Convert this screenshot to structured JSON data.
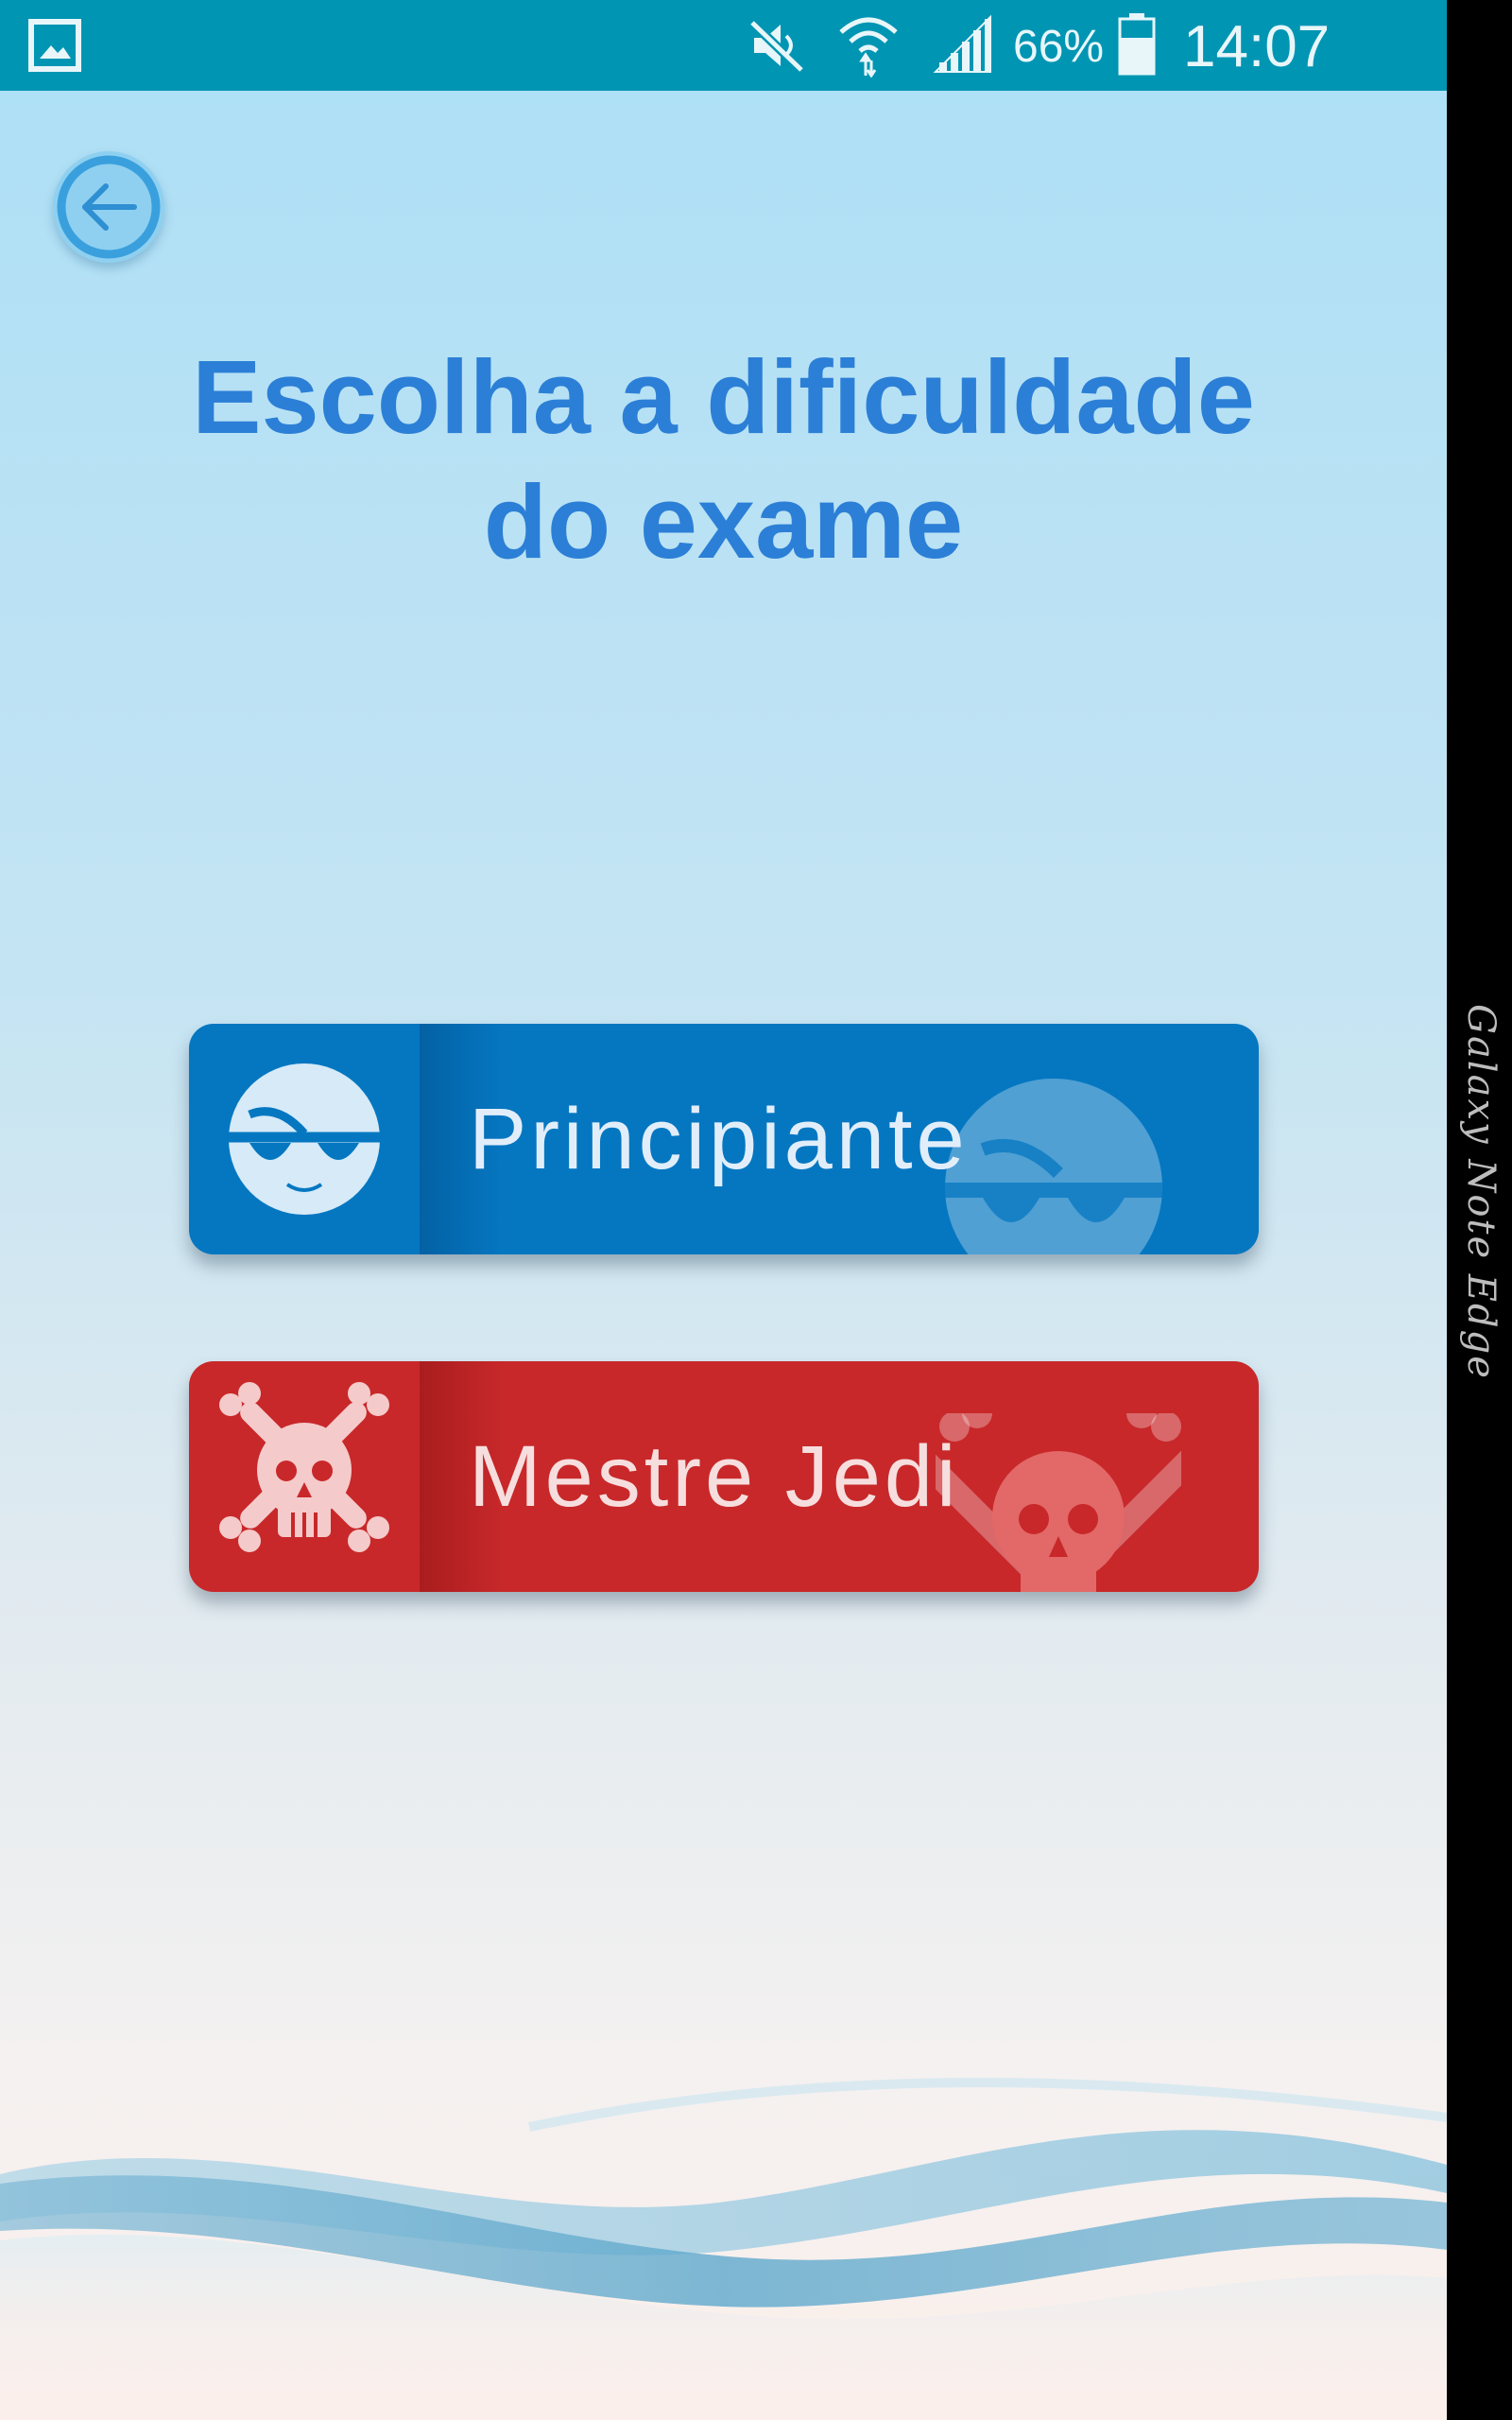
{
  "status_bar": {
    "battery_percent": "66%",
    "time": "14:07",
    "icons": [
      "gallery-icon",
      "mute-icon",
      "wifi-icon",
      "signal-icon",
      "battery-icon"
    ],
    "background_color": "#0095b3"
  },
  "edge_panel": {
    "text": "Galaxy Note Edge"
  },
  "header": {
    "back_icon": "arrow-left-icon",
    "title_line1": "Escolha a dificuldade",
    "title_line2": "do exame",
    "title_color": "#2c7fd6"
  },
  "difficulty_options": [
    {
      "label": "Principiante",
      "icon": "smiley-face-icon",
      "color": "#0577c1"
    },
    {
      "label": "Mestre Jedi",
      "icon": "skull-crossbones-icon",
      "color": "#c8282a"
    }
  ]
}
